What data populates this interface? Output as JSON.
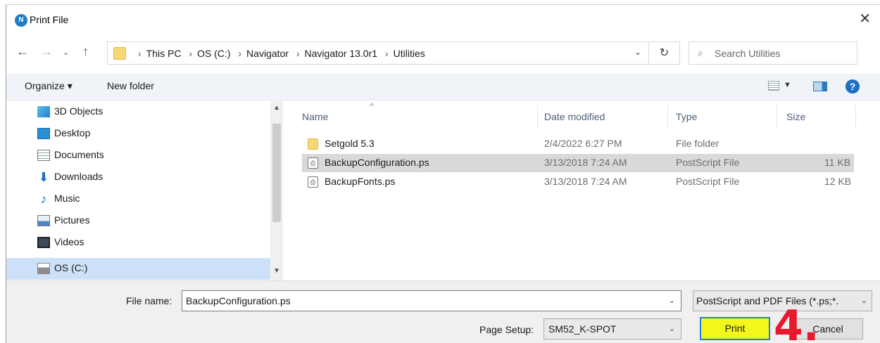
{
  "window": {
    "title": "Print File",
    "app_icon_text": "N"
  },
  "address": {
    "crumbs": [
      "This PC",
      "OS (C:)",
      "Navigator",
      "Navigator 13.0r1",
      "Utilities"
    ],
    "search_placeholder": "Search Utilities"
  },
  "toolbar": {
    "organize_label": "Organize ▾",
    "new_folder_label": "New folder"
  },
  "nav_pane": {
    "items": [
      {
        "label": "3D Objects",
        "icon": "3d-objects-icon"
      },
      {
        "label": "Desktop",
        "icon": "desktop-icon"
      },
      {
        "label": "Documents",
        "icon": "documents-icon"
      },
      {
        "label": "Downloads",
        "icon": "downloads-icon"
      },
      {
        "label": "Music",
        "icon": "music-icon"
      },
      {
        "label": "Pictures",
        "icon": "pictures-icon"
      },
      {
        "label": "Videos",
        "icon": "videos-icon"
      },
      {
        "label": "OS (C:)",
        "icon": "drive-icon",
        "selected": true
      }
    ]
  },
  "file_list": {
    "columns": [
      "Name",
      "Date modified",
      "Type",
      "Size"
    ],
    "rows": [
      {
        "name": "Setgold 5.3",
        "date": "2/4/2022 6:27 PM",
        "type": "File folder",
        "size": "",
        "icon": "folder-icon"
      },
      {
        "name": "BackupConfiguration.ps",
        "date": "3/13/2018 7:24 AM",
        "type": "PostScript File",
        "size": "11 KB",
        "icon": "postscript-file-icon",
        "selected": true
      },
      {
        "name": "BackupFonts.ps",
        "date": "3/13/2018 7:24 AM",
        "type": "PostScript File",
        "size": "12 KB",
        "icon": "postscript-file-icon"
      }
    ]
  },
  "bottom": {
    "file_name_label": "File name:",
    "file_name_value": "BackupConfiguration.ps",
    "file_type_value": "PostScript and PDF Files (*.ps;*.",
    "page_setup_label": "Page Setup:",
    "page_setup_value": "SM52_K-SPOT",
    "print_label": "Print",
    "cancel_label": "Cancel",
    "annotation_text": "4."
  },
  "colors": {
    "accent": "#1e6fc4",
    "selection": "#cce1f7",
    "highlight": "#f3f71b",
    "annotation": "#e8192c"
  }
}
